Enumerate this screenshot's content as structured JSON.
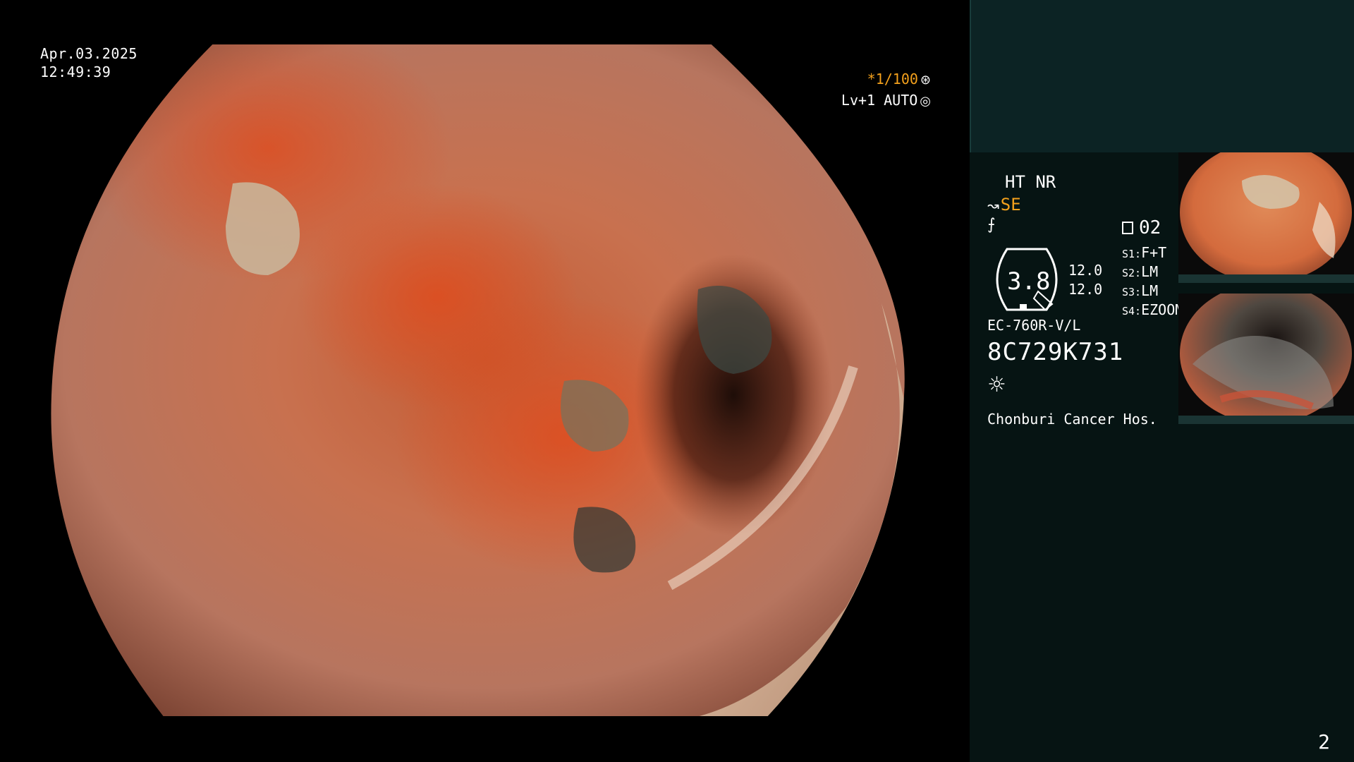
{
  "overlay": {
    "date": "Apr.03.2025",
    "time": "12:49:39",
    "shutter": "*1/100",
    "shutter_icon": "⊛",
    "level": "Lv+1 AUTO",
    "level_icon": "◎"
  },
  "panel": {
    "ht_nr": "HT NR",
    "mode_symbol": "↝",
    "mode": "SE",
    "f_symbol": "⨍",
    "memo_count": "02",
    "gauge_value": "3.8",
    "gauge_right_1": "12.0",
    "gauge_right_2": "12.0",
    "switches": [
      {
        "key": "S1:",
        "value": "F+T"
      },
      {
        "key": "S2:",
        "value": "LM"
      },
      {
        "key": "S3:",
        "value": "LM"
      },
      {
        "key": "S4:",
        "value": "EZOOM"
      }
    ],
    "scope_model": "EC-760R-V/L",
    "scope_serial": "8C729K731",
    "light_icon": "☼",
    "hospital": "Chonburi Cancer Hos."
  },
  "page_number": "2",
  "colors": {
    "accent": "#f4a11c",
    "panel_bg": "#061413",
    "panel_top_bg": "#0c2324",
    "text": "#ffffff"
  }
}
